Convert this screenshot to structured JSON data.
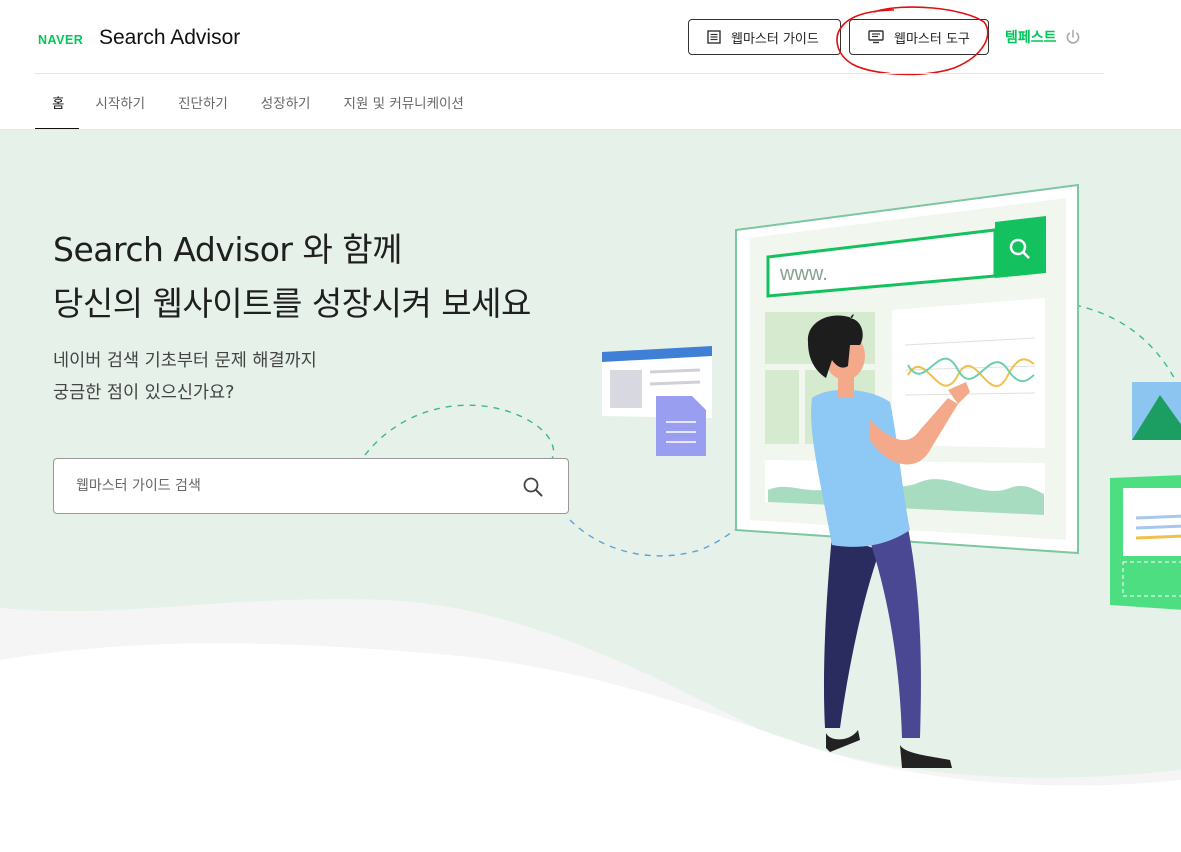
{
  "header": {
    "brand": "NAVER",
    "title": "Search Advisor",
    "guide_button": "웹마스터 가이드",
    "tools_button": "웹마스터 도구",
    "user_name": "템페스트",
    "icons": {
      "guide": "document-list-icon",
      "tools": "monitor-icon",
      "logout": "power-icon"
    }
  },
  "nav": {
    "items": [
      {
        "label": "홈",
        "active": true
      },
      {
        "label": "시작하기",
        "active": false
      },
      {
        "label": "진단하기",
        "active": false
      },
      {
        "label": "성장하기",
        "active": false
      },
      {
        "label": "지원 및 커뮤니케이션",
        "active": false
      }
    ]
  },
  "hero": {
    "title_line1": "Search Advisor 와 함께",
    "title_line2": "당신의 웹사이트를 성장시켜 보세요",
    "subtitle_line1": "네이버 검색 기초부터 문제 해결까지",
    "subtitle_line2": "궁금한 점이 있으신가요?",
    "search_placeholder": "웹마스터 가이드 검색",
    "illustration_url_text": "www."
  },
  "colors": {
    "brand_green": "#03c75a",
    "hero_bg": "#e6f1ea",
    "annotation_red": "#e01010"
  }
}
